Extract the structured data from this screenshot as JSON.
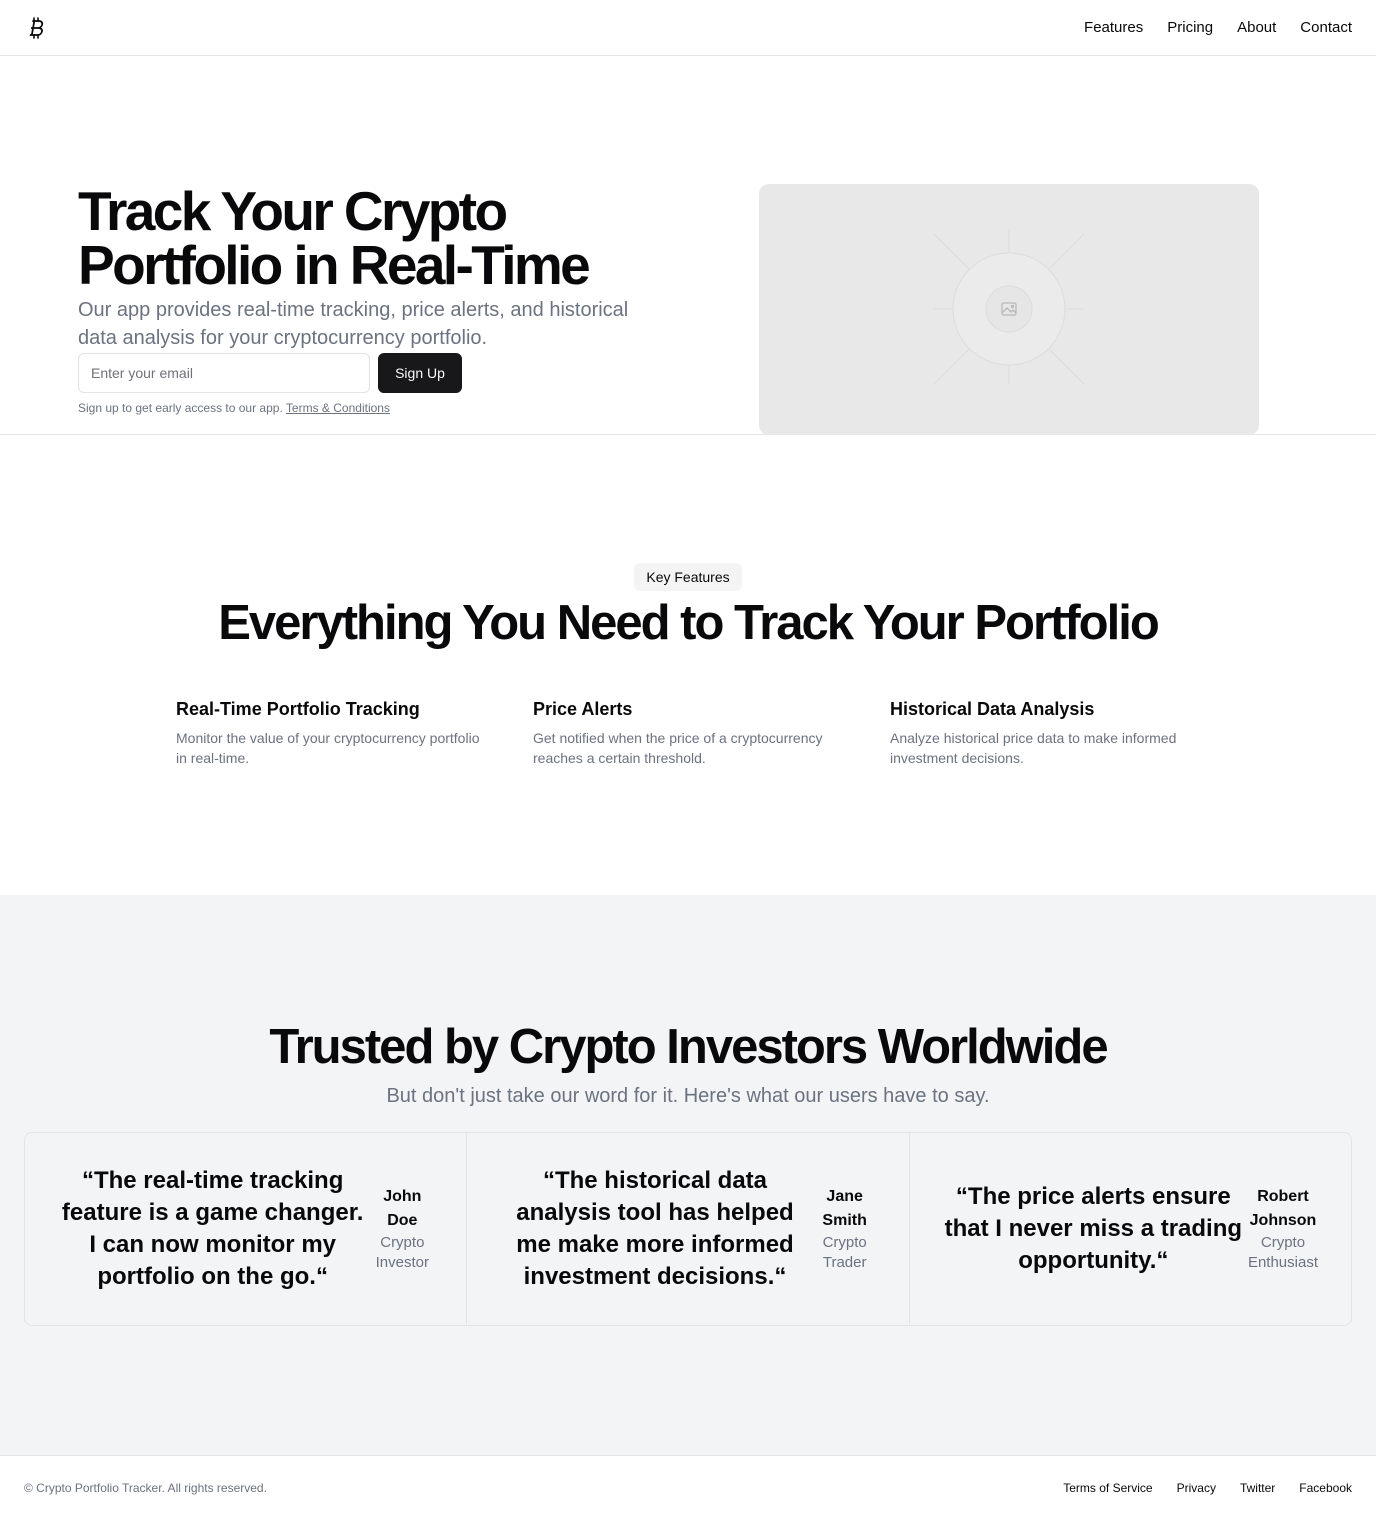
{
  "header": {
    "logo_icon": "bitcoin-icon",
    "nav": [
      {
        "label": "Features"
      },
      {
        "label": "Pricing"
      },
      {
        "label": "About"
      },
      {
        "label": "Contact"
      }
    ]
  },
  "hero": {
    "title_line1": "Track Your Crypto",
    "title_line2": "Portfolio in Real-Time",
    "subtitle": "Our app provides real-time tracking, price alerts, and historical data analysis for your cryptocurrency portfolio.",
    "email_placeholder": "Enter your email",
    "email_value": "",
    "signup_button": "Sign Up",
    "note": "Sign up to get early access to our app.",
    "terms_link": "Terms & Conditions",
    "image_icon": "image-placeholder-icon"
  },
  "features": {
    "badge": "Key Features",
    "title": "Everything You Need to Track Your Portfolio",
    "items": [
      {
        "title": "Real-Time Portfolio Tracking",
        "description": "Monitor the value of your cryptocurrency portfolio in real-time."
      },
      {
        "title": "Price Alerts",
        "description": "Get notified when the price of a cryptocurrency reaches a certain threshold."
      },
      {
        "title": "Historical Data Analysis",
        "description": "Analyze historical price data to make informed investment decisions."
      }
    ]
  },
  "testimonials": {
    "title": "Trusted by Crypto Investors Worldwide",
    "subtitle": "But don't just take our word for it. Here's what our users have to say.",
    "items": [
      {
        "quote": "“The real-time tracking feature is a game changer. I can now monitor my portfolio on the go.“",
        "name": "John Doe",
        "role": "Crypto Investor"
      },
      {
        "quote": "“The historical data analysis tool has helped me make more informed investment decisions.“",
        "name": "Jane Smith",
        "role": "Crypto Trader"
      },
      {
        "quote": "“The price alerts ensure that I never miss a trading opportunity.“",
        "name": "Robert Johnson",
        "role": "Crypto Enthusiast"
      }
    ]
  },
  "footer": {
    "copyright": "© Crypto Portfolio Tracker. All rights reserved.",
    "links": [
      {
        "label": "Terms of Service"
      },
      {
        "label": "Privacy"
      },
      {
        "label": "Twitter"
      },
      {
        "label": "Facebook"
      }
    ]
  },
  "colors": {
    "primary": "#18181b",
    "muted_text": "#6b7280",
    "section_bg": "#f3f4f6",
    "border": "#e4e4e7",
    "image_bg": "#e8e8e8"
  }
}
